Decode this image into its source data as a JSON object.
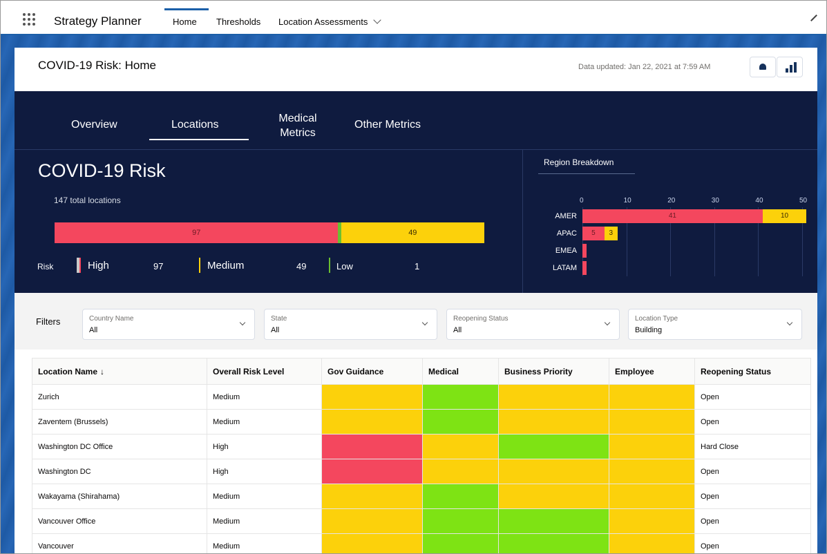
{
  "app": {
    "name": "Strategy Planner",
    "nav_tabs": [
      "Home",
      "Thresholds",
      "Location Assessments"
    ]
  },
  "header": {
    "title": "COVID-19 Risk: Home",
    "updated": "Data updated: Jan 22, 2021 at 7:59 AM"
  },
  "dashboard": {
    "tabs": [
      "Overview",
      "Locations",
      "Medical\nMetrics",
      "Other Metrics"
    ],
    "title": "COVID-19 Risk",
    "total": "147 total locations",
    "risk_bar": {
      "high": 97,
      "medium": 49,
      "low": 1
    },
    "risk_bar_labels": {
      "high": "97",
      "medium": "49"
    },
    "legend": {
      "risk_label": "Risk",
      "high_label": "High",
      "high_value": "97",
      "medium_label": "Medium",
      "medium_value": "49",
      "low_label": "Low",
      "low_value": "1"
    },
    "colors": {
      "high": "#f4475e",
      "medium": "#fcd10b",
      "low": "#6bbf31",
      "dark": "#0f1b3f"
    }
  },
  "chart_data": {
    "type": "bar",
    "title": "Region Breakdown",
    "categories": [
      "AMER",
      "APAC",
      "EMEA",
      "LATAM"
    ],
    "series": [
      {
        "name": "High",
        "values": [
          41,
          5,
          1,
          1
        ]
      },
      {
        "name": "Medium",
        "values": [
          10,
          3,
          0,
          0
        ]
      }
    ],
    "xlim": [
      0,
      50
    ],
    "ticks": [
      "0",
      "10",
      "20",
      "30",
      "40",
      "50"
    ],
    "orientation": "horizontal",
    "stacked": true
  },
  "filters": {
    "label": "Filters",
    "items": [
      {
        "label": "Country Name",
        "value": "All"
      },
      {
        "label": "State",
        "value": "All"
      },
      {
        "label": "Reopening Status",
        "value": "All"
      },
      {
        "label": "Location Type",
        "value": "Building"
      }
    ]
  },
  "table": {
    "columns": [
      "Location Name",
      "Overall Risk Level",
      "Gov Guidance",
      "Medical",
      "Business Priority",
      "Employee",
      "Reopening Status"
    ],
    "sort_indicator": "↓",
    "rows": [
      {
        "name": "Zurich",
        "risk": "Medium",
        "gov": "medium",
        "medical": "low",
        "business": "medium",
        "employee": "medium",
        "status": "Open"
      },
      {
        "name": "Zaventem (Brussels)",
        "risk": "Medium",
        "gov": "medium",
        "medical": "low",
        "business": "medium",
        "employee": "medium",
        "status": "Open"
      },
      {
        "name": "Washington DC Office",
        "risk": "High",
        "gov": "high",
        "medical": "medium",
        "business": "low",
        "employee": "medium",
        "status": "Hard Close"
      },
      {
        "name": "Washington DC",
        "risk": "High",
        "gov": "high",
        "medical": "medium",
        "business": "medium",
        "employee": "medium",
        "status": "Open"
      },
      {
        "name": "Wakayama (Shirahama)",
        "risk": "Medium",
        "gov": "medium",
        "medical": "low",
        "business": "medium",
        "employee": "medium",
        "status": "Open"
      },
      {
        "name": "Vancouver Office",
        "risk": "Medium",
        "gov": "medium",
        "medical": "low",
        "business": "low",
        "employee": "medium",
        "status": "Open"
      },
      {
        "name": "Vancouver",
        "risk": "Medium",
        "gov": "medium",
        "medical": "low",
        "business": "low",
        "employee": "medium",
        "status": "Open"
      }
    ]
  },
  "heat_colors": {
    "high": "#f4475e",
    "medium": "#fcd10b",
    "low": "#7ee314"
  }
}
